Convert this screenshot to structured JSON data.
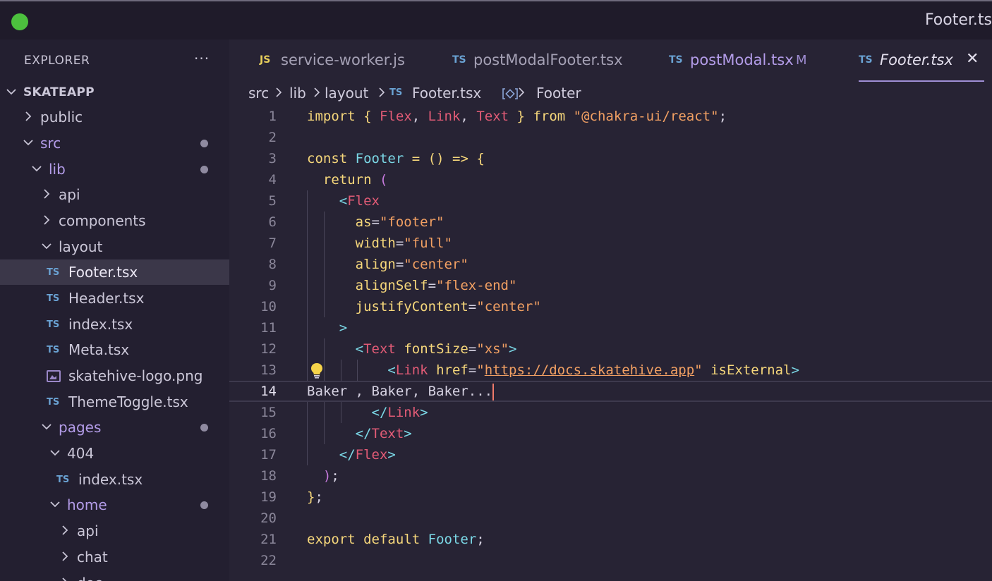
{
  "window": {
    "title": "Footer.ts"
  },
  "sidebar": {
    "title": "EXPLORER",
    "more": "···",
    "tree": [
      {
        "label": "SKATEAPP",
        "kind": "root",
        "expanded": true,
        "indent": 0,
        "dot": false
      },
      {
        "label": "public",
        "kind": "folder",
        "expanded": false,
        "indent": 1,
        "dot": false
      },
      {
        "label": "src",
        "kind": "folder",
        "expanded": true,
        "indent": 1,
        "dot": true
      },
      {
        "label": "lib",
        "kind": "folder",
        "expanded": true,
        "indent": 2,
        "dot": true
      },
      {
        "label": "api",
        "kind": "folder",
        "expanded": false,
        "indent": 3,
        "dot": false
      },
      {
        "label": "components",
        "kind": "folder",
        "expanded": false,
        "indent": 3,
        "dot": false
      },
      {
        "label": "layout",
        "kind": "folder",
        "expanded": true,
        "indent": 3,
        "dot": false
      },
      {
        "label": "Footer.tsx",
        "kind": "ts",
        "indent": 4,
        "dot": false,
        "selected": true
      },
      {
        "label": "Header.tsx",
        "kind": "ts",
        "indent": 4,
        "dot": false
      },
      {
        "label": "index.tsx",
        "kind": "ts",
        "indent": 4,
        "dot": false
      },
      {
        "label": "Meta.tsx",
        "kind": "ts",
        "indent": 4,
        "dot": false
      },
      {
        "label": "skatehive-logo.png",
        "kind": "image",
        "indent": 4,
        "dot": false
      },
      {
        "label": "ThemeToggle.tsx",
        "kind": "ts",
        "indent": 4,
        "dot": false
      },
      {
        "label": "pages",
        "kind": "folder",
        "expanded": true,
        "indent": 2,
        "dot": true
      },
      {
        "label": "404",
        "kind": "folder",
        "expanded": true,
        "indent": 3,
        "dot": false
      },
      {
        "label": "index.tsx",
        "kind": "ts",
        "indent": 4,
        "dot": false
      },
      {
        "label": "home",
        "kind": "folder",
        "expanded": true,
        "indent": 3,
        "dot": true
      },
      {
        "label": "api",
        "kind": "folder",
        "expanded": false,
        "indent": 4,
        "dot": false
      },
      {
        "label": "chat",
        "kind": "folder",
        "expanded": false,
        "indent": 4,
        "dot": false
      },
      {
        "label": "doc",
        "kind": "folder",
        "expanded": false,
        "indent": 4,
        "dot": false
      }
    ]
  },
  "tabs": [
    {
      "icon": "JS",
      "label": "service-worker.js",
      "mark": "",
      "active": false
    },
    {
      "icon": "TS",
      "label": "postModalFooter.tsx",
      "mark": "",
      "active": false
    },
    {
      "icon": "TS",
      "label": "postModal.tsx",
      "mark": "M",
      "active": false,
      "modified": true
    },
    {
      "icon": "TS",
      "label": "Footer.tsx",
      "mark": "",
      "active": true,
      "close": "✕"
    }
  ],
  "breadcrumb": {
    "items": [
      "src",
      "lib",
      "layout",
      "Footer.tsx",
      "Footer"
    ],
    "separator": ">",
    "file_icon": "TS"
  },
  "editor": {
    "current_line": 14,
    "lines": [
      {
        "n": "1",
        "tokens": [
          [
            "kw",
            "import"
          ],
          [
            "",
            " "
          ],
          [
            "br1",
            "{"
          ],
          [
            "",
            " "
          ],
          [
            "cmp",
            "Flex"
          ],
          [
            "",
            ", "
          ],
          [
            "cmp",
            "Link"
          ],
          [
            "",
            ", "
          ],
          [
            "cmp",
            "Text"
          ],
          [
            "",
            " "
          ],
          [
            "br1",
            "}"
          ],
          [
            "",
            " "
          ],
          [
            "kw",
            "from"
          ],
          [
            "",
            " "
          ],
          [
            "str",
            "\"@chakra-ui/react\""
          ],
          [
            "",
            ";"
          ]
        ]
      },
      {
        "n": "2",
        "tokens": []
      },
      {
        "n": "3",
        "tokens": [
          [
            "kw",
            "const"
          ],
          [
            "",
            " "
          ],
          [
            "fn",
            "Footer"
          ],
          [
            "",
            " "
          ],
          [
            "kw",
            "="
          ],
          [
            "",
            " "
          ],
          [
            "br1",
            "()"
          ],
          [
            "",
            " "
          ],
          [
            "kw",
            "=>"
          ],
          [
            "",
            " "
          ],
          [
            "br1",
            "{"
          ]
        ]
      },
      {
        "n": "4",
        "tokens": [
          [
            "",
            "  "
          ],
          [
            "kw",
            "return"
          ],
          [
            "",
            " "
          ],
          [
            "br2",
            "("
          ]
        ]
      },
      {
        "n": "5",
        "tokens": [
          [
            "",
            "    "
          ],
          [
            "pun",
            "<"
          ],
          [
            "cmp",
            "Flex"
          ]
        ]
      },
      {
        "n": "6",
        "tokens": [
          [
            "",
            "      "
          ],
          [
            "attr",
            "as"
          ],
          [
            "",
            "="
          ],
          [
            "str",
            "\"footer\""
          ]
        ]
      },
      {
        "n": "7",
        "tokens": [
          [
            "",
            "      "
          ],
          [
            "attr",
            "width"
          ],
          [
            "",
            "="
          ],
          [
            "str",
            "\"full\""
          ]
        ]
      },
      {
        "n": "8",
        "tokens": [
          [
            "",
            "      "
          ],
          [
            "attr",
            "align"
          ],
          [
            "",
            "="
          ],
          [
            "str",
            "\"center\""
          ]
        ]
      },
      {
        "n": "9",
        "tokens": [
          [
            "",
            "      "
          ],
          [
            "attr",
            "alignSelf"
          ],
          [
            "",
            "="
          ],
          [
            "str",
            "\"flex-end\""
          ]
        ]
      },
      {
        "n": "10",
        "tokens": [
          [
            "",
            "      "
          ],
          [
            "attr",
            "justifyContent"
          ],
          [
            "",
            "="
          ],
          [
            "str",
            "\"center\""
          ]
        ]
      },
      {
        "n": "11",
        "tokens": [
          [
            "",
            "    "
          ],
          [
            "pun",
            ">"
          ]
        ]
      },
      {
        "n": "12",
        "tokens": [
          [
            "",
            "      "
          ],
          [
            "pun",
            "<"
          ],
          [
            "cmp",
            "Text"
          ],
          [
            "",
            " "
          ],
          [
            "attr",
            "fontSize"
          ],
          [
            "",
            "="
          ],
          [
            "str",
            "\"xs\""
          ],
          [
            "pun",
            ">"
          ]
        ]
      },
      {
        "n": "13",
        "tokens": [
          [
            "",
            "          "
          ],
          [
            "pun",
            "<"
          ],
          [
            "cmp",
            "Link"
          ],
          [
            "",
            " "
          ],
          [
            "attr",
            "href"
          ],
          [
            "",
            "="
          ],
          [
            "str",
            "\""
          ],
          [
            "url",
            "https://docs.skatehive.app"
          ],
          [
            "str",
            "\""
          ],
          [
            "",
            " "
          ],
          [
            "attr",
            "isExternal"
          ],
          [
            "pun",
            ">"
          ]
        ]
      },
      {
        "n": "14",
        "tokens": [
          [
            "",
            "Baker , Baker, Baker..."
          ]
        ],
        "cursor": true
      },
      {
        "n": "15",
        "tokens": [
          [
            "",
            "        "
          ],
          [
            "pun",
            "</"
          ],
          [
            "cmp",
            "Link"
          ],
          [
            "pun",
            ">"
          ]
        ]
      },
      {
        "n": "16",
        "tokens": [
          [
            "",
            "      "
          ],
          [
            "pun",
            "</"
          ],
          [
            "cmp",
            "Text"
          ],
          [
            "pun",
            ">"
          ]
        ]
      },
      {
        "n": "17",
        "tokens": [
          [
            "",
            "    "
          ],
          [
            "pun",
            "</"
          ],
          [
            "cmp",
            "Flex"
          ],
          [
            "pun",
            ">"
          ]
        ]
      },
      {
        "n": "18",
        "tokens": [
          [
            "",
            "  "
          ],
          [
            "br2",
            ")"
          ],
          [
            "",
            ";"
          ]
        ]
      },
      {
        "n": "19",
        "tokens": [
          [
            "br1",
            "}"
          ],
          [
            "",
            ";"
          ]
        ]
      },
      {
        "n": "20",
        "tokens": []
      },
      {
        "n": "21",
        "tokens": [
          [
            "kw",
            "export"
          ],
          [
            "",
            " "
          ],
          [
            "kw",
            "default"
          ],
          [
            "",
            " "
          ],
          [
            "fn",
            "Footer"
          ],
          [
            "",
            ";"
          ]
        ]
      },
      {
        "n": "22",
        "tokens": []
      }
    ]
  },
  "colors": {
    "keyword": "#f6d77b",
    "component": "#e25b76",
    "string": "#f2a063",
    "function": "#7bd8e6",
    "selected_row": "#3b3749",
    "traffic_green": "#4cc03e"
  },
  "icons": {
    "lightbulb": "lightbulb-icon",
    "chevron_right": "chevron-right-icon",
    "chevron_down": "chevron-down-icon",
    "close": "close-icon"
  }
}
